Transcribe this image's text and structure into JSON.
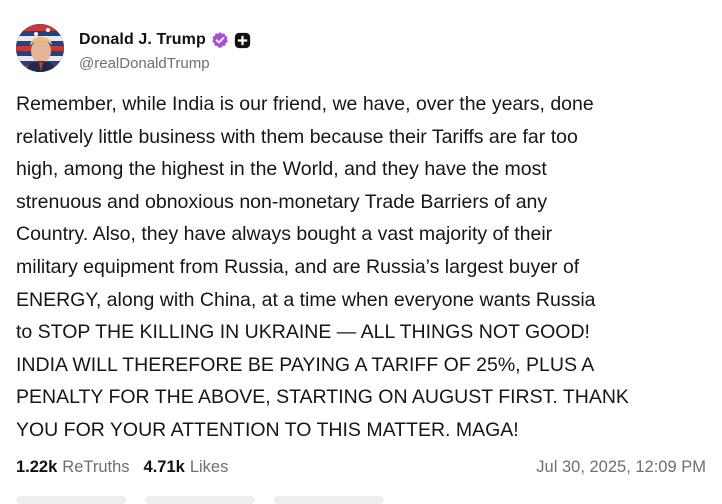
{
  "author": {
    "display_name": "Donald J. Trump",
    "handle": "@realDonaldTrump",
    "avatar_icon": "profile-photo",
    "verified_icon": "verified-badge-icon",
    "verified_color": "#a94ed6",
    "plus_icon": "plus-badge-icon"
  },
  "post": {
    "lines": [
      "Remember, while India is our friend, we have, over the years, done",
      "relatively little business with them because their Tariffs are far too",
      "high, among the highest in the World, and they have the most",
      "strenuous and obnoxious non-monetary Trade Barriers of any",
      "Country. Also, they have always bought a vast majority of their",
      "military equipment from Russia, and are Russia’s largest buyer of",
      "ENERGY, along with China, at a time when everyone wants Russia",
      "to STOP THE KILLING IN UKRAINE — ALL THINGS NOT GOOD!",
      "INDIA WILL THEREFORE BE PAYING A TARIFF OF 25%, PLUS A",
      "PENALTY FOR THE ABOVE, STARTING ON AUGUST FIRST. THANK",
      "YOU FOR YOUR ATTENTION TO THIS MATTER. MAGA!"
    ]
  },
  "stats": {
    "retruths_count": "1.22k",
    "retruths_label": "ReTruths",
    "likes_count": "4.71k",
    "likes_label": "Likes",
    "timestamp": "Jul 30, 2025, 12:09 PM"
  }
}
